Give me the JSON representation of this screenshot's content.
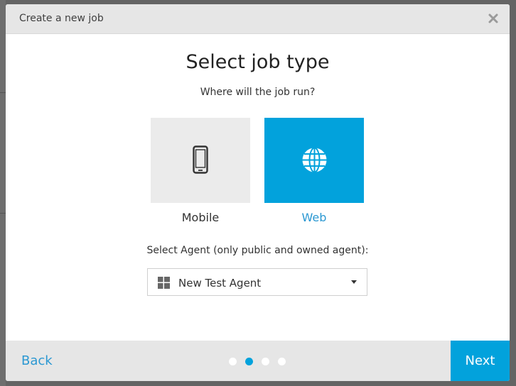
{
  "modal": {
    "title": "Create a new job",
    "close_icon": "close-icon"
  },
  "content": {
    "heading": "Select job type",
    "subheading": "Where will the job run?",
    "job_types": [
      {
        "label": "Mobile",
        "icon": "mobile-phone-icon",
        "selected": false
      },
      {
        "label": "Web",
        "icon": "globe-icon",
        "selected": true
      }
    ],
    "agent_label": "Select Agent (only public and owned agent):",
    "agent_select": {
      "value": "New Test Agent",
      "icon": "windows-icon"
    }
  },
  "footer": {
    "back_label": "Back",
    "next_label": "Next",
    "steps_total": 4,
    "current_step": 2
  },
  "colors": {
    "accent": "#02a2dc",
    "link": "#2b98d2",
    "header_bg": "#e6e6e6",
    "tile_bg": "#ebebeb"
  }
}
